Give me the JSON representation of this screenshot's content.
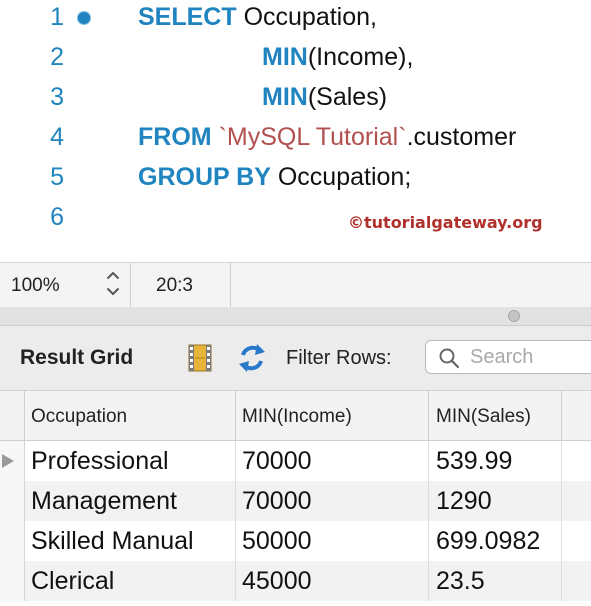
{
  "editor": {
    "line_numbers": [
      "1",
      "2",
      "3",
      "4",
      "5",
      "6"
    ],
    "lines": [
      [
        {
          "t": "SELECT",
          "k": "kw"
        },
        {
          "t": " Occupation,",
          "k": "plain"
        }
      ],
      [
        {
          "t": "MIN",
          "k": "kw"
        },
        {
          "t": "(Income),",
          "k": "plain"
        }
      ],
      [
        {
          "t": "MIN",
          "k": "kw"
        },
        {
          "t": "(Sales)",
          "k": "plain"
        }
      ],
      [
        {
          "t": "FROM",
          "k": "kw"
        },
        {
          "t": " ",
          "k": "plain"
        },
        {
          "t": "`MySQL Tutorial`",
          "k": "str"
        },
        {
          "t": ".customer",
          "k": "plain"
        }
      ],
      [
        {
          "t": "GROUP BY",
          "k": "kw"
        },
        {
          "t": " Occupation;",
          "k": "plain"
        }
      ],
      []
    ],
    "watermark": "©tutorialgateway.org",
    "colors": {
      "keyword": "#1f84bf",
      "string": "#b24f4f",
      "line_number": "#1f84bf"
    }
  },
  "statusbar": {
    "zoom": "100%",
    "cursor_position": "20:3"
  },
  "result_panel": {
    "title": "Result Grid",
    "filter_label": "Filter Rows:",
    "search_placeholder": "Search",
    "icons": [
      "grid-view-icon",
      "refresh-icon",
      "search-icon"
    ]
  },
  "table": {
    "columns": [
      "Occupation",
      "MIN(Income)",
      "MIN(Sales)"
    ],
    "rows": [
      [
        "Professional",
        "70000",
        "539.99"
      ],
      [
        "Management",
        "70000",
        "1290"
      ],
      [
        "Skilled Manual",
        "50000",
        "699.0982"
      ],
      [
        "Clerical",
        "45000",
        "23.5"
      ]
    ]
  }
}
